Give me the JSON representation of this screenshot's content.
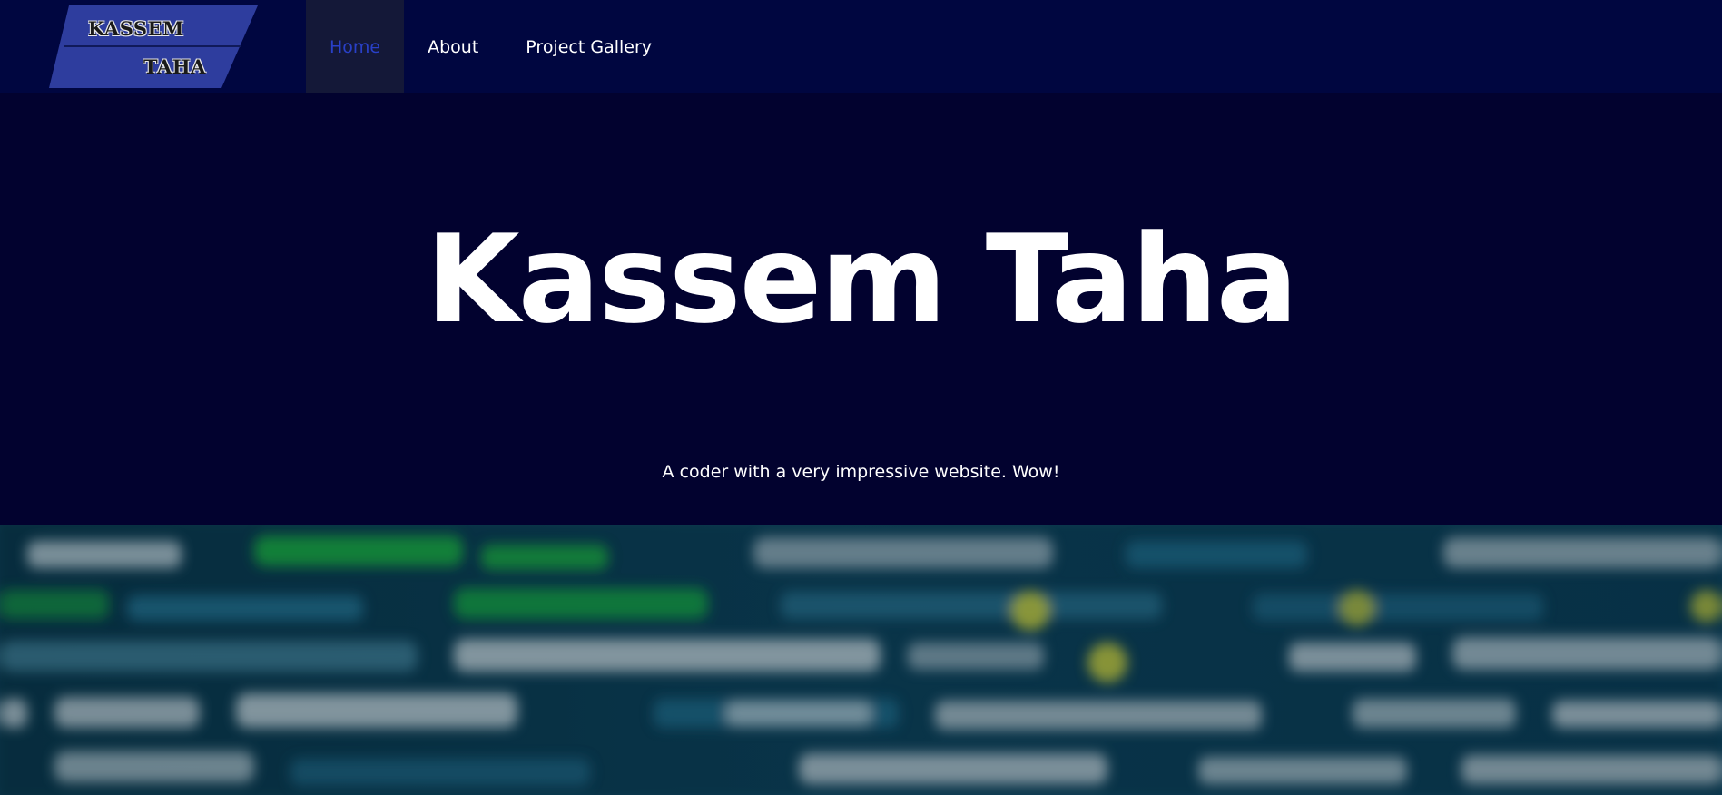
{
  "logo": {
    "line1": "KASSEM",
    "line2": "TAHA",
    "colors": {
      "fill": "#2e3d9e",
      "text": "#1a1a1a",
      "outline": "#e8e8e8"
    }
  },
  "nav": {
    "items": [
      {
        "label": "Home",
        "active": true
      },
      {
        "label": "About",
        "active": false
      },
      {
        "label": "Project Gallery",
        "active": false
      }
    ],
    "colors": {
      "bar": "#000640",
      "active_bg": "#141838",
      "active_text": "#2940c8",
      "text": "#ffffff"
    }
  },
  "hero": {
    "title": "Kassem Taha",
    "subtitle": "A coder with a very impressive website. Wow!",
    "background": "#02022f"
  },
  "banner": {
    "description_icon": "blurred-code-image",
    "colors": {
      "base": "#0d3b52",
      "green": "#1ec83c",
      "yellow": "#e6e23a",
      "white": "#e8eef2",
      "teal": "#2b7fa0"
    }
  }
}
